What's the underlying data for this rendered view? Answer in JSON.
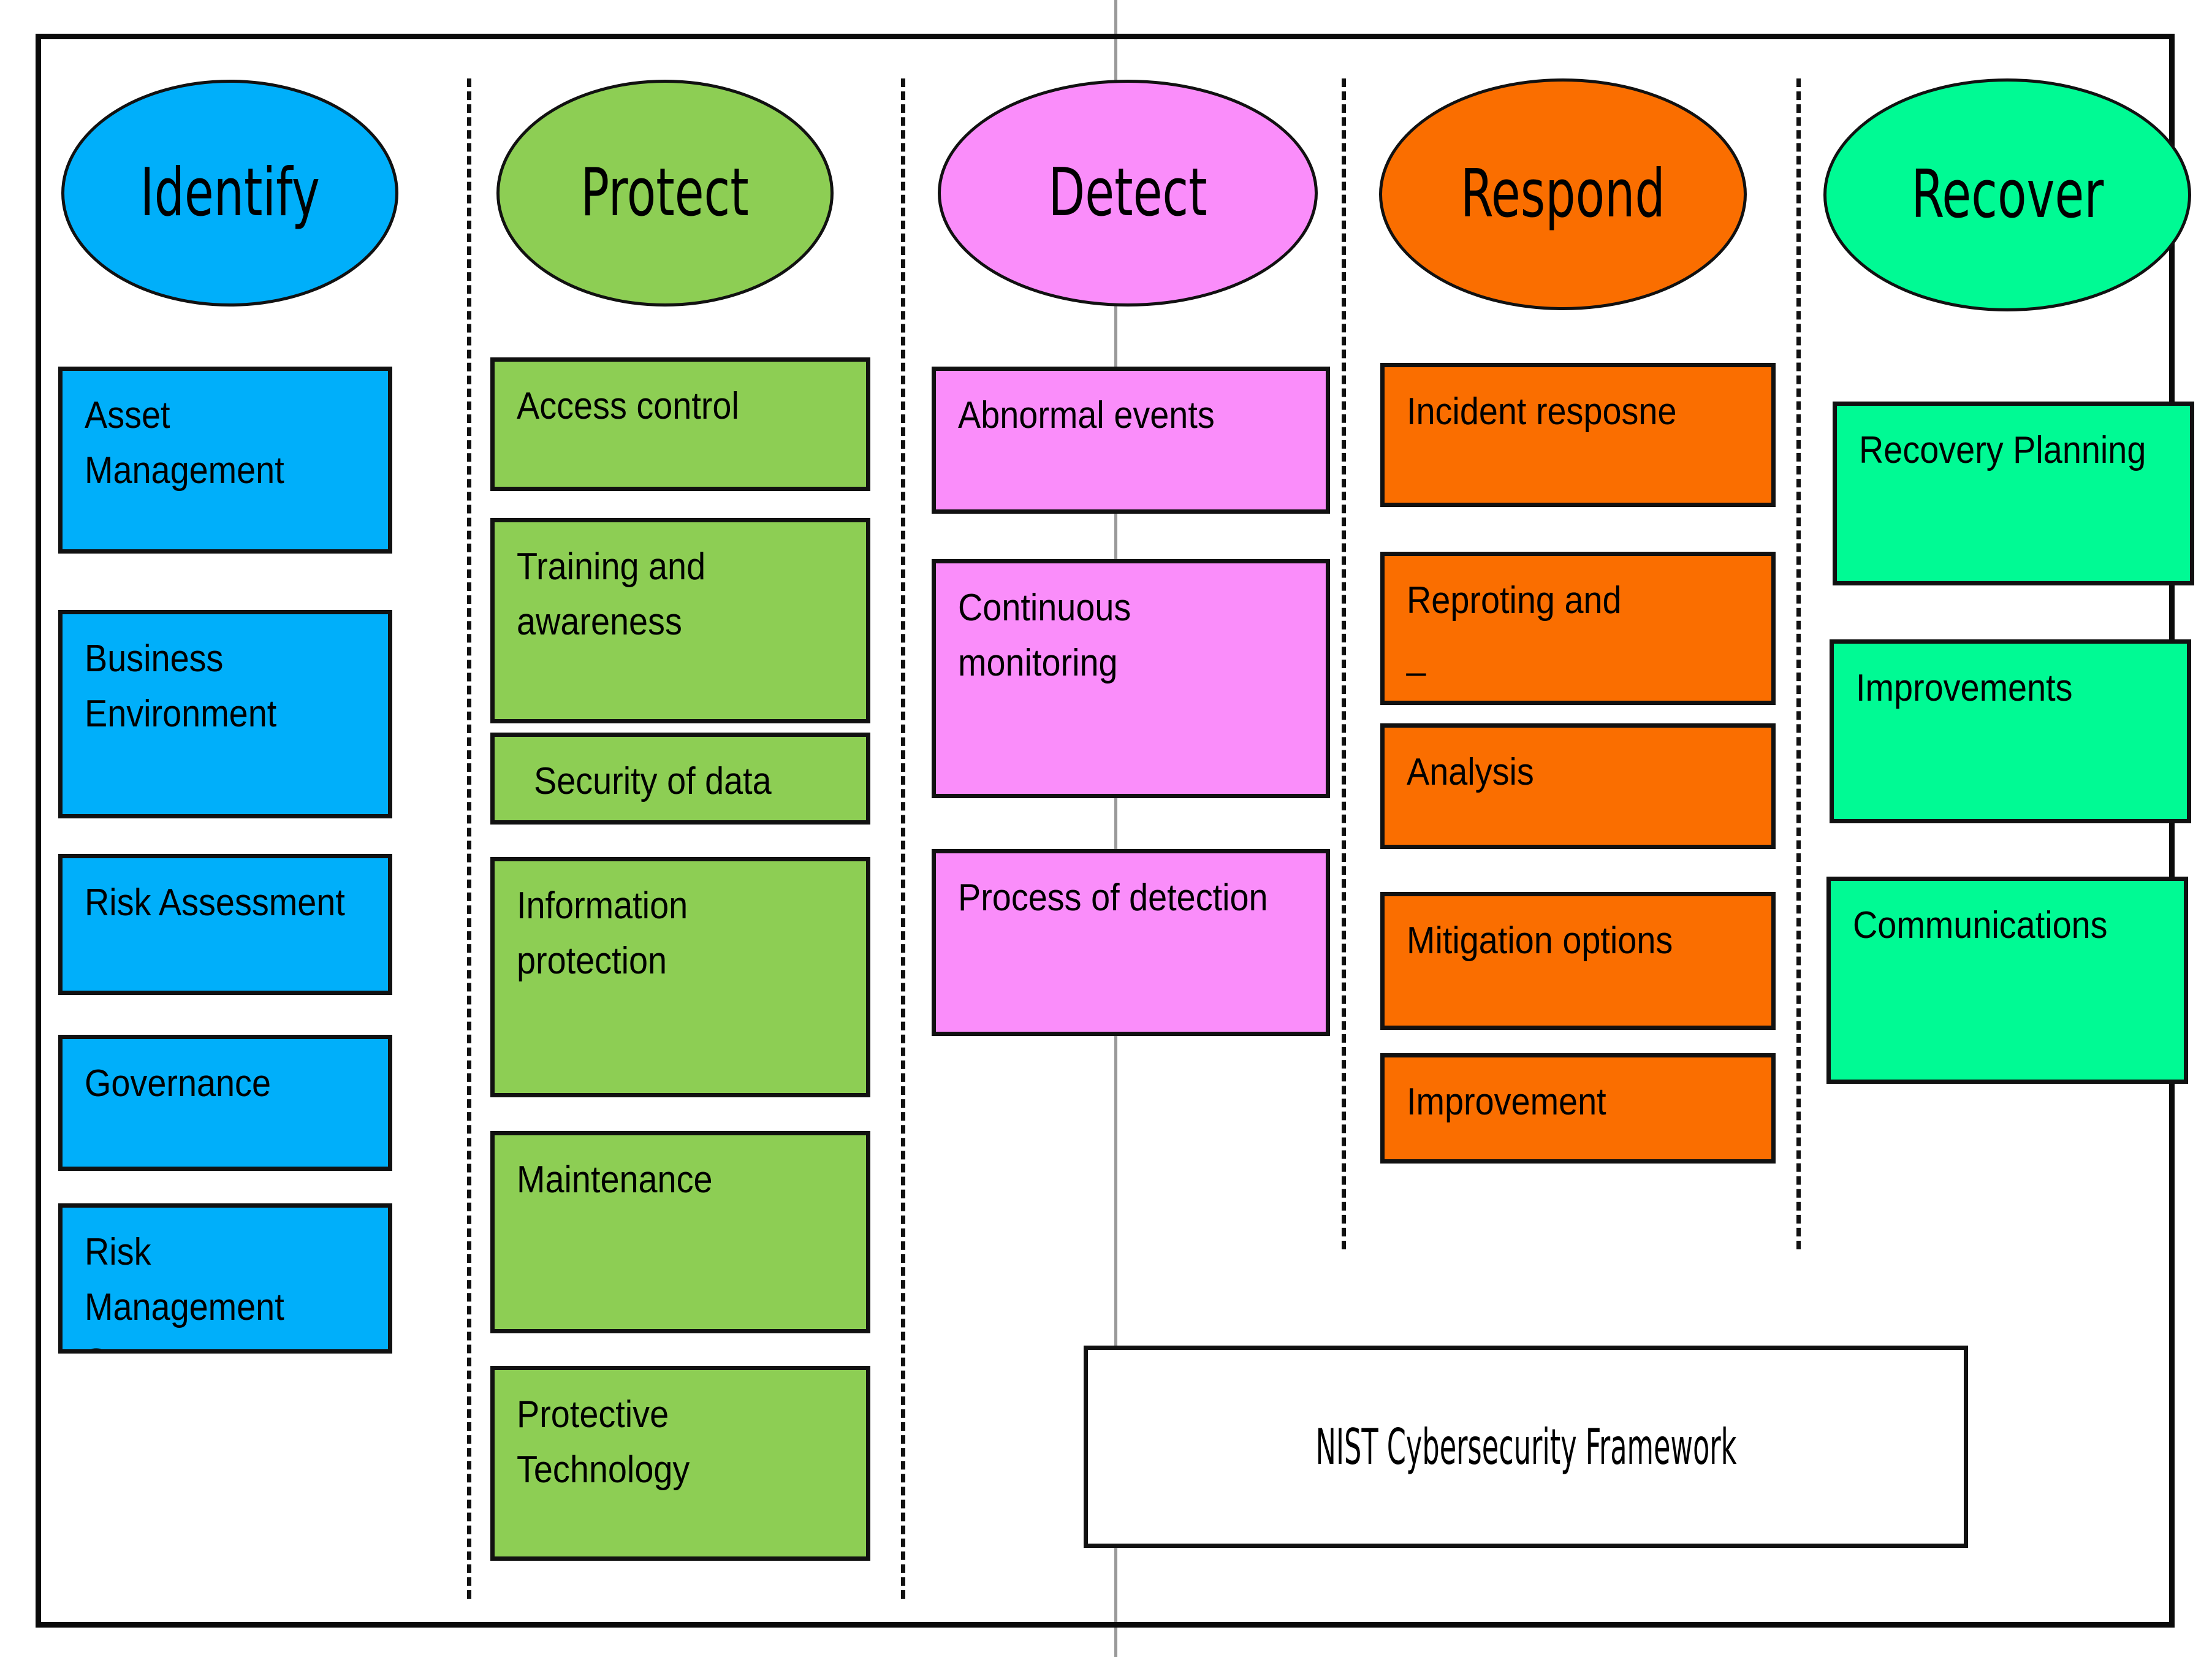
{
  "diagram": {
    "caption": "NIST Cybersecurity Framework",
    "colors": {
      "identify": "#00AFFA",
      "protect": "#8DCE54",
      "detect": "#FA8DFA",
      "respond": "#FA6E00",
      "recover": "#00FA94",
      "outline": "#111111",
      "background": "#FFFFFF",
      "grey_rule": "#9A9A9A"
    },
    "columns": [
      {
        "id": "identify",
        "title": "Identify",
        "color": "#00AFFA",
        "items": [
          "Asset Management",
          "Business\nEnvironment",
          "Risk Assessment",
          "Governance",
          "Risk     Management\nStrategy"
        ]
      },
      {
        "id": "protect",
        "title": "Protect",
        "color": "#8DCE54",
        "items": [
          "Access control",
          "Training and\nawareness",
          "Security of data",
          "Information\nprotection",
          "Maintenance",
          "Protective\nTechnology"
        ]
      },
      {
        "id": "detect",
        "title": "Detect",
        "color": "#FA8DFA",
        "items": [
          "Abnormal events",
          "Continuous\nmonitoring",
          "Process of detection"
        ]
      },
      {
        "id": "respond",
        "title": "Respond",
        "color": "#FA6E00",
        "items": [
          "Incident resposne",
          "Reproting and\n_",
          "Analysis",
          "Mitigation options",
          "Improvement"
        ]
      },
      {
        "id": "recover",
        "title": "Recover",
        "color": "#00FA94",
        "items": [
          "Recovery Planning",
          "Improvements",
          "Communications"
        ]
      }
    ]
  }
}
